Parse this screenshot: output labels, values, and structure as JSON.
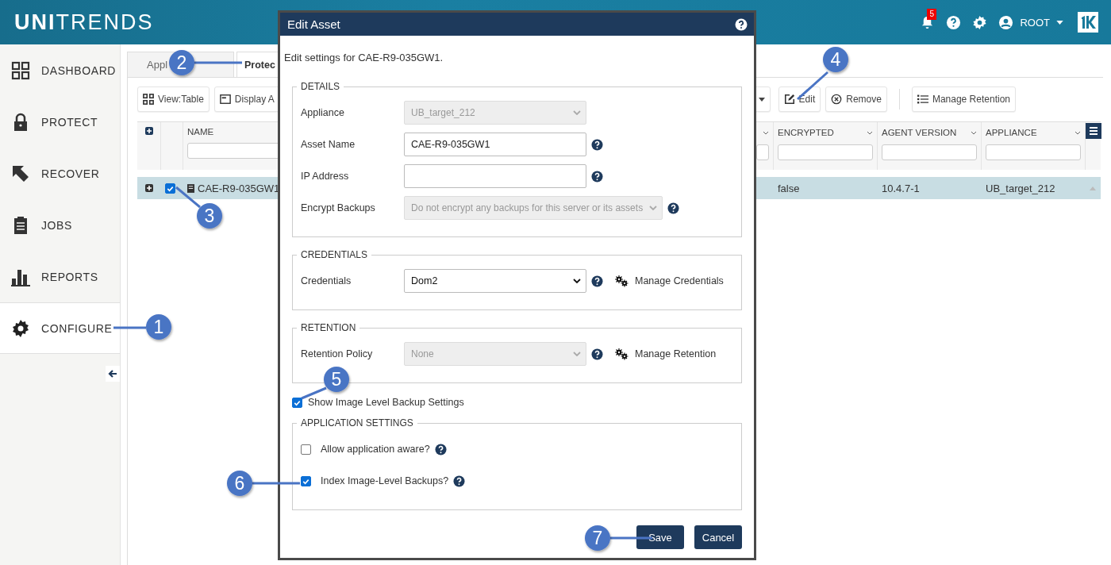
{
  "header": {
    "logo": "**UNI**TRENDS",
    "notifications": "5",
    "user": "ROOT"
  },
  "sidebar": {
    "items": [
      {
        "label": "DASHBOARD",
        "selected": false
      },
      {
        "label": "PROTECT",
        "selected": false
      },
      {
        "label": "RECOVER",
        "selected": false
      },
      {
        "label": "JOBS",
        "selected": false
      },
      {
        "label": "REPORTS",
        "selected": false
      },
      {
        "label": "CONFIGURE",
        "selected": true
      }
    ]
  },
  "tabs": [
    {
      "label": "Appl",
      "selected": false
    },
    {
      "label": "Protec",
      "selected": true
    }
  ],
  "toolbar": {
    "left": [
      "View:Table",
      "Display A"
    ],
    "right": [
      "Edit",
      "Remove"
    ],
    "retention": "Manage Retention"
  },
  "table": {
    "columns": [
      "NAME",
      "ENCRYPTED",
      "AGENT VERSION",
      "APPLIANCE"
    ],
    "rows": [
      {
        "selected": true,
        "checked": true,
        "cells": [
          "CAE-R9-035GW1",
          "false",
          "10.4.7-1",
          "UB_target_212"
        ]
      }
    ]
  },
  "dialog": {
    "title": "Edit Asset",
    "intro": "Edit settings for CAE-R9-035GW1.",
    "sections": [
      {
        "legend": "DETAILS",
        "fields": [
          {
            "label": "Appliance",
            "kind": "select",
            "value": "UB_target_212",
            "disabled": true
          },
          {
            "label": "Asset Name",
            "kind": "input",
            "value": "CAE-R9-035GW1",
            "help": true
          },
          {
            "label": "IP Address",
            "kind": "input",
            "help": true
          },
          {
            "label": "Encrypt Backups",
            "kind": "select",
            "value": "Do not encrypt any backups for this server or its assets",
            "disabled": true,
            "help": true
          }
        ]
      },
      {
        "legend": "CREDENTIALS",
        "fields": [
          {
            "label": "Credentials",
            "kind": "select",
            "value": "Dom2",
            "disabled": false,
            "help": true,
            "link": "Manage Credentials"
          }
        ]
      },
      {
        "legend": "RETENTION",
        "fields": [
          {
            "label": "Retention Policy",
            "kind": "select",
            "value": "None",
            "disabled": true,
            "help": true,
            "link": "Manage Retention"
          }
        ]
      }
    ],
    "toggle": {
      "label": "Show Image Level Backup Settings",
      "checked": true
    },
    "app_settings": {
      "legend": "APPLICATION SETTINGS",
      "fields": [
        {
          "label": "Allow application aware?",
          "kind": "checkbox",
          "checked": false,
          "help": true
        },
        {
          "label": "Index Image-Level Backups?",
          "kind": "checkbox",
          "checked": true,
          "help": true
        }
      ]
    },
    "buttons": [
      "Save",
      "Cancel"
    ]
  },
  "callouts": [
    "1",
    "2",
    "3",
    "4",
    "5",
    "6",
    "7"
  ]
}
